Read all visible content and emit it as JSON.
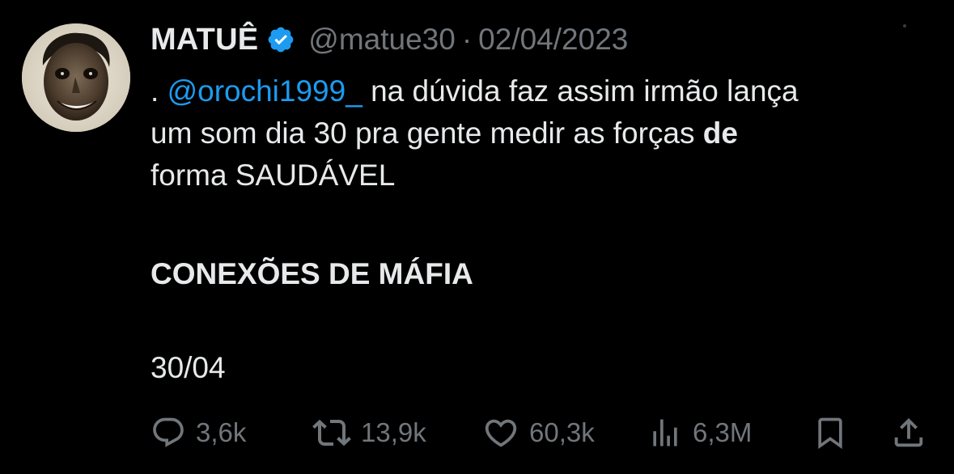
{
  "author": {
    "name": "MATUÊ",
    "handle": "@matue30",
    "separator": "·",
    "date": "02/04/2023",
    "avatar_icon": "avatar-face",
    "verified_icon": "verified-badge-icon"
  },
  "tweet": {
    "prefix": ". ",
    "mention": "@orochi1999_",
    "line1_rest": " na dúvida faz assim irmão lança",
    "line2_start": "um som dia 30 pra gente medir as forças ",
    "line2_bold": "de",
    "line3": "forma SAUDÁVEL",
    "title": "CONEXÕES DE MÁFIA",
    "release_date": "30/04"
  },
  "actions": {
    "replies": "3,6k",
    "retweets": "13,9k",
    "likes": "60,3k",
    "views": "6,3M"
  },
  "colors": {
    "background": "#000000",
    "text": "#e7e9ea",
    "muted": "#71767b",
    "accent": "#1d9bf0"
  }
}
